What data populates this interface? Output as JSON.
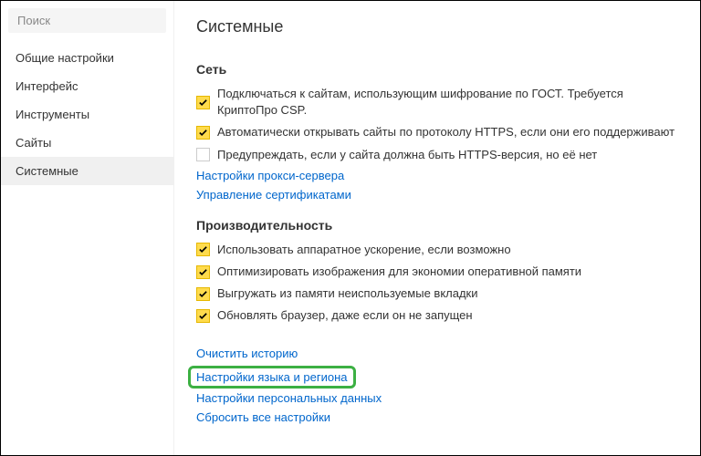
{
  "sidebar": {
    "search_placeholder": "Поиск",
    "items": [
      {
        "label": "Общие настройки",
        "active": false
      },
      {
        "label": "Интерфейс",
        "active": false
      },
      {
        "label": "Инструменты",
        "active": false
      },
      {
        "label": "Сайты",
        "active": false
      },
      {
        "label": "Системные",
        "active": true
      }
    ]
  },
  "main": {
    "title": "Системные",
    "sections": {
      "network": {
        "title": "Сеть",
        "checkboxes": [
          {
            "label": "Подключаться к сайтам, использующим шифрование по ГОСТ. Требуется КриптоПро CSP.",
            "checked": true
          },
          {
            "label": "Автоматически открывать сайты по протоколу HTTPS, если они его поддерживают",
            "checked": true
          },
          {
            "label": "Предупреждать, если у сайта должна быть HTTPS-версия, но её нет",
            "checked": false
          }
        ],
        "links": [
          "Настройки прокси-сервера",
          "Управление сертификатами"
        ]
      },
      "performance": {
        "title": "Производительность",
        "checkboxes": [
          {
            "label": "Использовать аппаратное ускорение, если возможно",
            "checked": true
          },
          {
            "label": "Оптимизировать изображения для экономии оперативной памяти",
            "checked": true
          },
          {
            "label": "Выгружать из памяти неиспользуемые вкладки",
            "checked": true
          },
          {
            "label": "Обновлять браузер, даже если он не запущен",
            "checked": true
          }
        ]
      }
    },
    "bottom_links": {
      "clear_history": "Очистить историю",
      "language_region": "Настройки языка и региона",
      "personal_data": "Настройки персональных данных",
      "reset_all": "Сбросить все настройки"
    }
  }
}
